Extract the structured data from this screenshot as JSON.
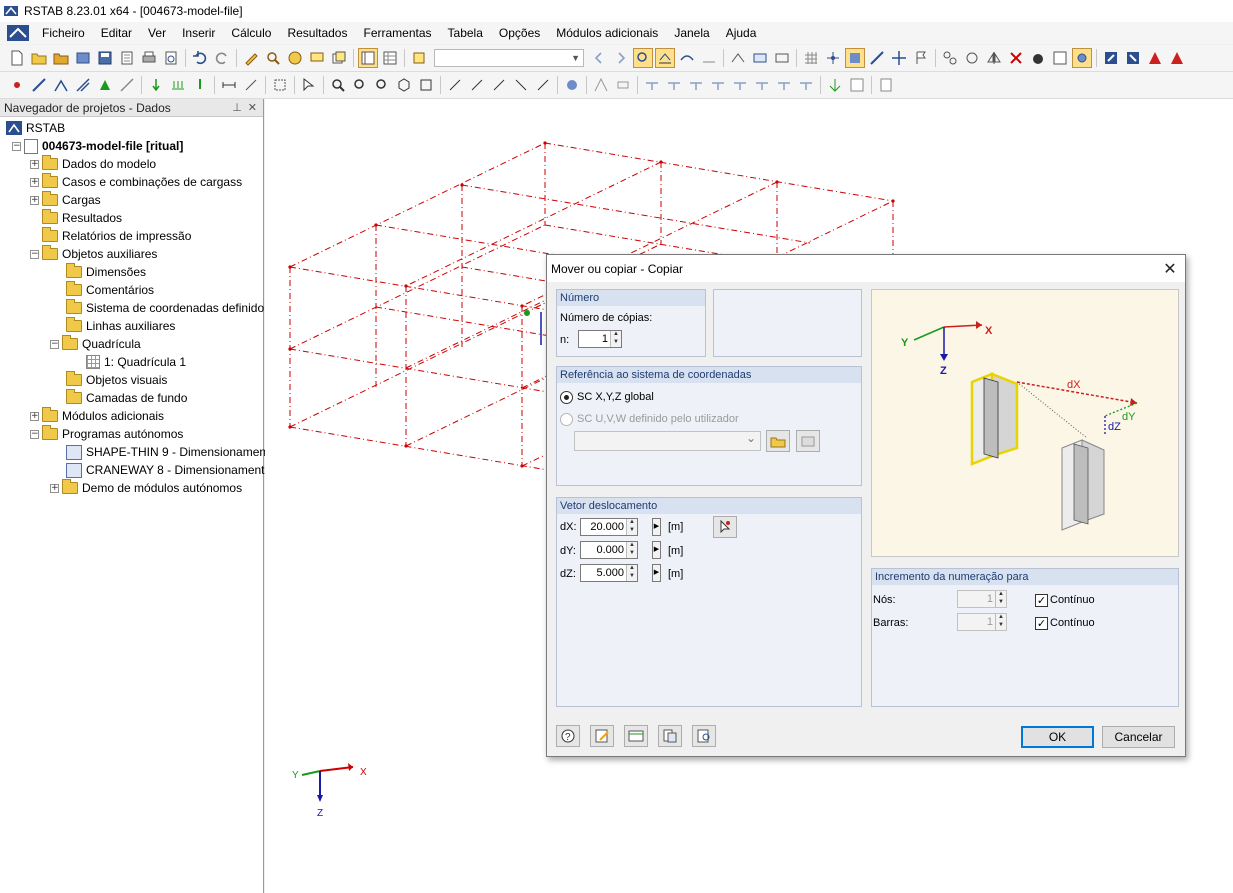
{
  "window": {
    "title": "RSTAB 8.23.01 x64 - [004673-model-file]"
  },
  "menu": [
    "Ficheiro",
    "Editar",
    "Ver",
    "Inserir",
    "Cálculo",
    "Resultados",
    "Ferramentas",
    "Tabela",
    "Opções",
    "Módulos adicionais",
    "Janela",
    "Ajuda"
  ],
  "navigator": {
    "title": "Navegador de projetos - Dados",
    "root": "RSTAB",
    "project": "004673-model-file [ritual]",
    "items": [
      "Dados do modelo",
      "Casos e combinações de cargass",
      "Cargas",
      "Resultados",
      "Relatórios de impressão",
      "Objetos auxiliares",
      "Dimensões",
      "Comentários",
      "Sistema de coordenadas definido",
      "Linhas auxiliares",
      "Quadrícula",
      "1: Quadrícula 1",
      "Objetos visuais",
      "Camadas de fundo",
      "Módulos adicionais",
      "Programas autónomos",
      "SHAPE-THIN 9 - Dimensionamen",
      "CRANEWAY 8 - Dimensionament",
      "Demo de módulos autónomos"
    ]
  },
  "axes": {
    "x": "X",
    "y": "Y",
    "z": "Z"
  },
  "dialog": {
    "title": "Mover ou copiar - Copiar",
    "numero": {
      "header": "Número",
      "label": "Número de cópias:",
      "n_label": "n:",
      "n_value": "1"
    },
    "referencia": {
      "header": "Referência ao sistema de coordenadas",
      "option_global": "SC X,Y,Z global",
      "option_user": "SC U,V,W definido pelo utilizador"
    },
    "vetor": {
      "header": "Vetor deslocamento",
      "dx_label": "dX:",
      "dy_label": "dY:",
      "dz_label": "dZ:",
      "dx_value": "20.000",
      "dy_value": "0.000",
      "dz_value": "5.000",
      "unit": "[m]"
    },
    "preview": {
      "x": "X",
      "y": "Y",
      "z": "Z",
      "dx": "dX",
      "dy": "dY",
      "dz": "dZ"
    },
    "incremento": {
      "header": "Incremento da numeração para",
      "nos_label": "Nós:",
      "barras_label": "Barras:",
      "nos_value": "1",
      "barras_value": "1",
      "continuo": "Contínuo"
    },
    "buttons": {
      "ok": "OK",
      "cancel": "Cancelar"
    }
  },
  "colors": {
    "accent": "#0078d7",
    "model_lines": "#cc0000",
    "axis_x": "#cc0000",
    "axis_y": "#1a9a1a",
    "axis_z": "#1a1aaa"
  }
}
